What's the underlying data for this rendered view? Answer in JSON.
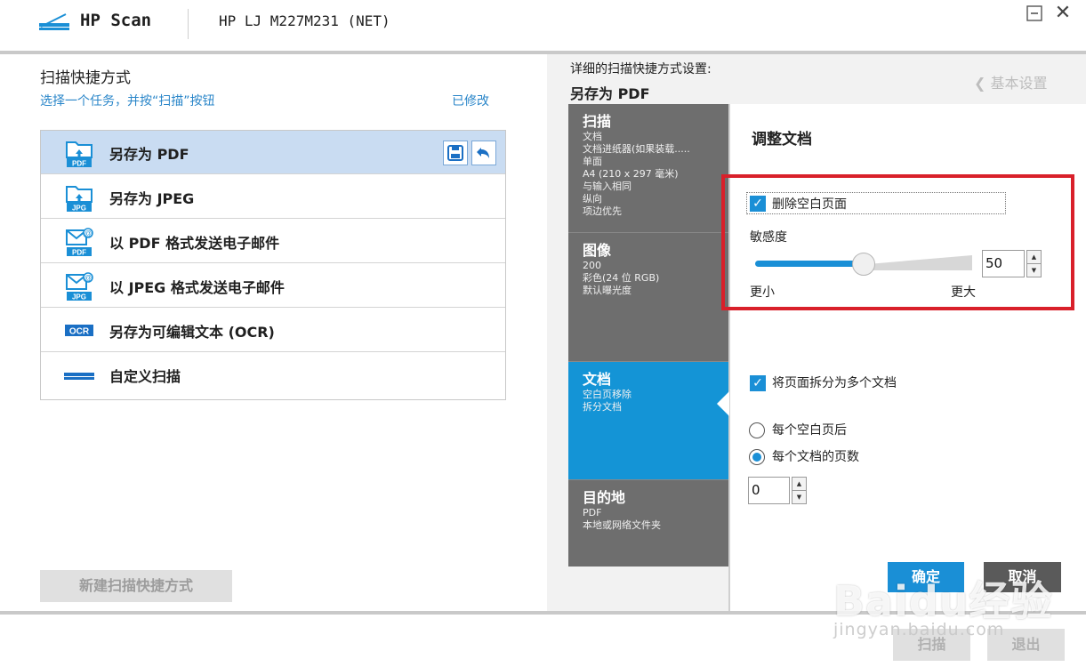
{
  "titlebar": {
    "app_name": "HP Scan",
    "device": "HP LJ M227M231 (NET)",
    "close_glyph": "✕"
  },
  "left": {
    "title": "扫描快捷方式",
    "subtitle": "选择一个任务，并按“扫描”按钮",
    "modified": "已修改",
    "shortcuts": [
      {
        "label": "另存为 PDF",
        "icon": "pdf-folder-icon",
        "selected": true
      },
      {
        "label": "另存为 JPEG",
        "icon": "jpg-folder-icon",
        "selected": false
      },
      {
        "label": "以 PDF 格式发送电子邮件",
        "icon": "pdf-email-icon",
        "selected": false
      },
      {
        "label": "以 JPEG 格式发送电子邮件",
        "icon": "jpg-email-icon",
        "selected": false
      },
      {
        "label": "另存为可编辑文本 (OCR)",
        "icon": "ocr-icon",
        "selected": false
      },
      {
        "label": "自定义扫描",
        "icon": "scanner-icon",
        "selected": false
      }
    ],
    "new_shortcut": "新建扫描快捷方式"
  },
  "right": {
    "detail_label": "详细的扫描快捷方式设置:",
    "detail_name": "另存为 PDF",
    "basic_settings": "基本设置",
    "categories": [
      {
        "title": "扫描",
        "lines": [
          "文档",
          "文档进纸器(如果装载.....",
          "单面",
          "A4 (210 x 297 毫米)",
          "与输入相同",
          "纵向",
          "项边优先"
        ]
      },
      {
        "title": "图像",
        "lines": [
          "200",
          "彩色(24 位 RGB)",
          "默认曝光度"
        ]
      },
      {
        "title": "文档",
        "lines": [
          "空白页移除",
          "拆分文档"
        ]
      },
      {
        "title": "目的地",
        "lines": [
          "PDF",
          "本地或网络文件夹"
        ]
      }
    ],
    "pane_title": "调整文档",
    "remove_blank": "删除空白页面",
    "sensitivity_label": "敏感度",
    "sensitivity_value": "50",
    "sensitivity_fraction": 0.5,
    "smaller": "更小",
    "larger": "更大",
    "split_docs": "将页面拆分为多个文档",
    "after_blank": "每个空白页后",
    "pages_per_doc": "每个文档的页数",
    "pages_value": "0",
    "ok": "确定",
    "cancel": "取消"
  },
  "bottom": {
    "scan": "扫描",
    "exit": "退出"
  },
  "watermark": {
    "logo": "Baidu经验",
    "url": "jingyan.baidu.com"
  },
  "colors": {
    "accent": "#1a8fd6",
    "selected_row": "#c9dcf2",
    "category_bg": "#6e6e6e",
    "highlight": "#d9202a"
  }
}
